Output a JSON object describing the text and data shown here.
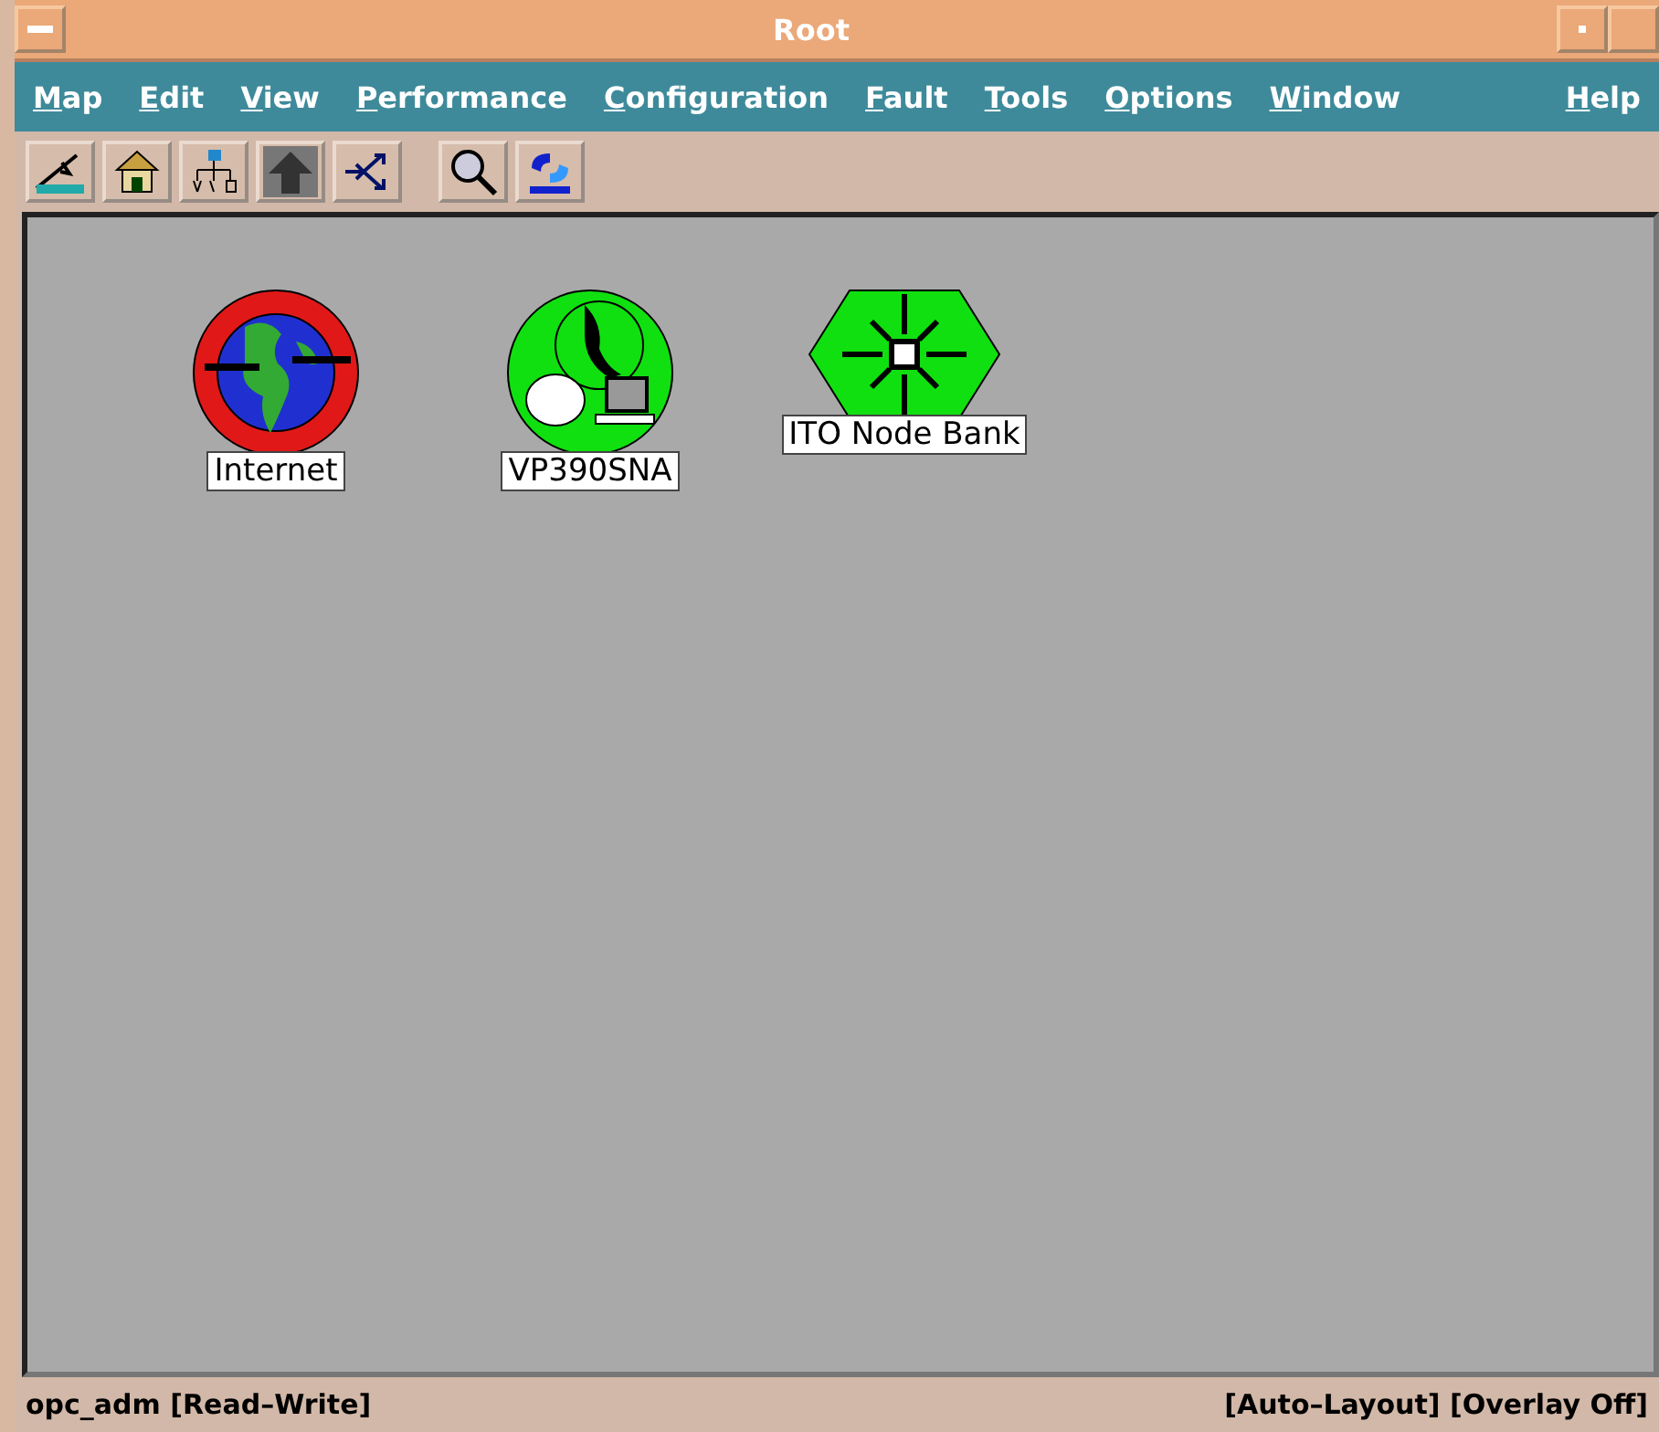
{
  "window": {
    "title": "Root"
  },
  "menu": [
    "Map",
    "Edit",
    "View",
    "Performance",
    "Configuration",
    "Fault",
    "Tools",
    "Options",
    "Window"
  ],
  "help_menu": "Help",
  "toolbar": [
    {
      "kind": "close"
    },
    {
      "kind": "home"
    },
    {
      "kind": "tree"
    },
    {
      "kind": "parent"
    },
    {
      "kind": "route"
    },
    {
      "kind": "search"
    },
    {
      "kind": "logo"
    }
  ],
  "symbols": [
    {
      "label": "Internet",
      "kind": "globe",
      "color": "#e01818"
    },
    {
      "label": "VP390SNA",
      "kind": "sna",
      "color": "#10e010"
    },
    {
      "label": "ITO Node Bank",
      "kind": "bank",
      "color": "#10e010"
    }
  ],
  "status_bar": {
    "left": "opc_adm [Read–Write]",
    "right": "[Auto–Layout] [Overlay Off]"
  }
}
